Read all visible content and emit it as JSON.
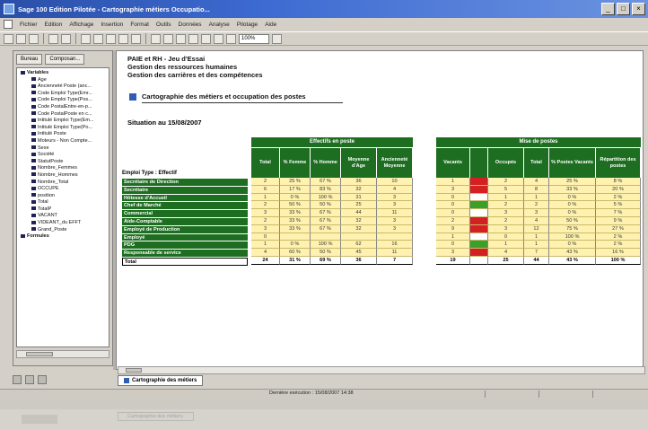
{
  "window": {
    "title": "Sage 100 Edition Pilotée - Cartographie métiers Occupatio..."
  },
  "menu": [
    "Fichier",
    "Edition",
    "Affichage",
    "Insertion",
    "Format",
    "Outils",
    "Données",
    "Analyse",
    "Pilotage",
    "Aide"
  ],
  "toolbar": {
    "zoom": "100%"
  },
  "left_panel": {
    "tabs": [
      "Bureau",
      "Composan..."
    ],
    "tree": [
      {
        "label": "Variables",
        "level": 0
      },
      {
        "label": "Age",
        "level": 1
      },
      {
        "label": "Ancienneté Poste (anc...",
        "level": 1
      },
      {
        "label": "Code Emploi Type(Emr...",
        "level": 1
      },
      {
        "label": "Code Emploi Type(Pos...",
        "level": 1
      },
      {
        "label": "Code PostalEntre-en-p...",
        "level": 1
      },
      {
        "label": "Code PostalPoste en c...",
        "level": 1
      },
      {
        "label": "Intitulé Emploi Type(Em...",
        "level": 1
      },
      {
        "label": "Intitulé Emploi Type(Po...",
        "level": 1
      },
      {
        "label": "Intitulé Poste",
        "level": 1
      },
      {
        "label": "Moteurs - Non Compte...",
        "level": 1
      },
      {
        "label": "Sexe",
        "level": 1
      },
      {
        "label": "Société",
        "level": 1
      },
      {
        "label": "StatutPoste",
        "level": 1
      },
      {
        "label": "Nombre_Femmes",
        "level": 1
      },
      {
        "label": "Nombre_Hommes",
        "level": 1
      },
      {
        "label": "Nombre_Total",
        "level": 1
      },
      {
        "label": "OCCUPE",
        "level": 1
      },
      {
        "label": "position",
        "level": 1
      },
      {
        "label": "Total",
        "level": 1
      },
      {
        "label": "TotalP",
        "level": 1
      },
      {
        "label": "VACANT",
        "level": 1
      },
      {
        "label": "VIDEANT_du EFFT",
        "level": 1
      },
      {
        "label": "Grand_Poste",
        "level": 1
      },
      {
        "label": "Formules",
        "level": 0
      }
    ]
  },
  "document": {
    "header": [
      "PAIE et RH - Jeu d'Essai",
      "Gestion des ressources humaines",
      "Gestion des carrières et des compétences"
    ],
    "title": "Cartographie des métiers et occupation des postes",
    "situation": "Situation au 15/08/2007",
    "employment_header": "Emploi Type : Effectif",
    "block1": {
      "title": "Effectifs en poste",
      "columns": [
        "Total",
        "% Femme",
        "% Homme",
        "Moyenne d'Age",
        "Ancienneté Moyenne"
      ]
    },
    "block2": {
      "title": "Mise de postes",
      "columns": [
        "Vacants",
        "",
        "Occupés",
        "Total",
        "% Postes Vacants",
        "Répartition des postes"
      ]
    },
    "rows": [
      {
        "label": "Secrétaire de Direction",
        "t1": [
          "2",
          "25 %",
          "67 %",
          "36",
          "10"
        ],
        "t2": [
          "1",
          "red",
          "2",
          "4",
          "25 %",
          "8 %"
        ]
      },
      {
        "label": "Secrétaire",
        "t1": [
          "6",
          "17 %",
          "83 %",
          "32",
          "4"
        ],
        "t2": [
          "3",
          "red",
          "5",
          "8",
          "33 %",
          "20 %"
        ]
      },
      {
        "label": "Hôtesse d'Accueil",
        "t1": [
          "1",
          "0 %",
          "100 %",
          "31",
          "3"
        ],
        "t2": [
          "0",
          "blank",
          "1",
          "1",
          "0 %",
          "2 %"
        ]
      },
      {
        "label": "Chef de Marché",
        "t1": [
          "2",
          "50 %",
          "50 %",
          "25",
          "3"
        ],
        "t2": [
          "0",
          "green",
          "2",
          "2",
          "0 %",
          "5 %"
        ]
      },
      {
        "label": "Commercial",
        "t1": [
          "3",
          "33 %",
          "67 %",
          "44",
          "11"
        ],
        "t2": [
          "0",
          "blank",
          "3",
          "3",
          "0 %",
          "7 %"
        ]
      },
      {
        "label": "Aide-Comptable",
        "t1": [
          "2",
          "33 %",
          "67 %",
          "32",
          "3"
        ],
        "t2": [
          "2",
          "red",
          "2",
          "4",
          "50 %",
          "9 %"
        ]
      },
      {
        "label": "Employé de Production",
        "t1": [
          "3",
          "33 %",
          "67 %",
          "32",
          "3"
        ],
        "t2": [
          "9",
          "red",
          "3",
          "12",
          "75 %",
          "27 %"
        ]
      },
      {
        "label": "Employé",
        "t1": [
          "0",
          "",
          "",
          "",
          ""
        ],
        "t2": [
          "1",
          "blank",
          "0",
          "1",
          "100 %",
          "2 %"
        ]
      },
      {
        "label": "PDG",
        "t1": [
          "1",
          "0 %",
          "100 %",
          "62",
          "16"
        ],
        "t2": [
          "0",
          "green",
          "1",
          "1",
          "0 %",
          "2 %"
        ]
      },
      {
        "label": "Responsable de service",
        "t1": [
          "4",
          "60 %",
          "50 %",
          "45",
          "11"
        ],
        "t2": [
          "3",
          "red",
          "4",
          "7",
          "43 %",
          "16 %"
        ]
      }
    ],
    "total": {
      "label": "Total",
      "t1": [
        "24",
        "31 %",
        "69 %",
        "36",
        "7"
      ],
      "t2": [
        "19",
        "",
        "25",
        "44",
        "43 %",
        "100 %"
      ]
    }
  },
  "tabs": {
    "active": "Cartographie des métiers"
  },
  "status": {
    "text": "Dernière exécution : 15/08/2007 14:38"
  },
  "ghost": {
    "tab": "Cartographie des métiers"
  }
}
